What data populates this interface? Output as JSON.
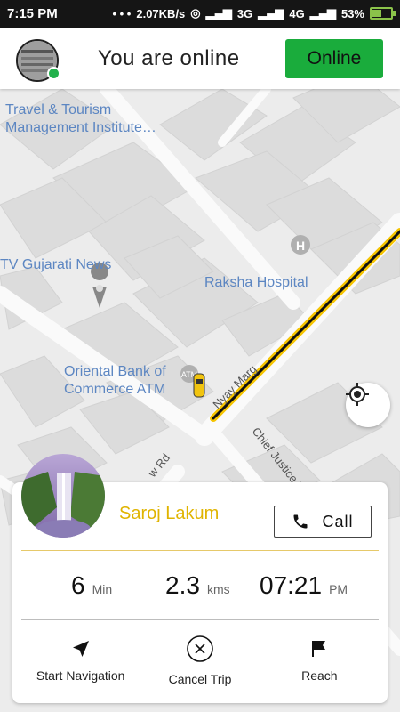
{
  "status_bar": {
    "time": "7:15 PM",
    "net_speed": "2.07KB/s",
    "network_labels": [
      "3G",
      "4G"
    ],
    "battery": "53%"
  },
  "header": {
    "title": "You are online",
    "status_button": "Online"
  },
  "map": {
    "labels": {
      "institute": "Travel & Tourism\nManagement Institute…",
      "news": "TV Gujarati News",
      "hospital": "Raksha Hospital",
      "bank": "Oriental Bank of\nCommerce ATM",
      "road1": "Nyay Marg",
      "road2": "Chief Justice B",
      "road3": "w Rd"
    },
    "route_color": "#f5c400"
  },
  "trip": {
    "rider_name": "Saroj Lakum",
    "call_label": "Call",
    "time_value": "6",
    "time_unit": "Min",
    "distance_value": "2.3",
    "distance_unit": "kms",
    "eta_value": "07:21",
    "eta_unit": "PM",
    "actions": {
      "start": "Start Navigation",
      "cancel": "Cancel Trip",
      "reach": "Reach"
    }
  }
}
